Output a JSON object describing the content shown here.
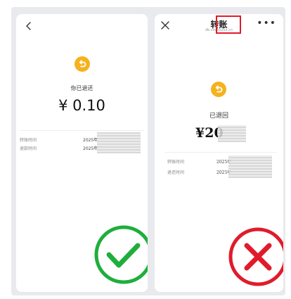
{
  "colors": {
    "accent_yellow": "#f5b21e",
    "check_green": "#1fae3c",
    "cross_red": "#e11b2c",
    "highlight_box": "#e11b2c"
  },
  "left_screen": {
    "back_icon": "chevron-left-icon",
    "status_text": "你已退还",
    "amount": "¥ 0.10",
    "transfer_time_label": "转账时间",
    "transfer_time_value": "2025年",
    "refund_time_label": "退款时间",
    "refund_time_value": "2025年",
    "verdict_icon": "check-icon"
  },
  "right_screen": {
    "close_icon": "close-icon",
    "header_title": "转账",
    "header_subtitle": "db.xxxxxxxx.cn",
    "more_icon": "more-icon",
    "status_text": "已退回",
    "amount": "¥20",
    "transfer_time_label": "转账时间",
    "transfer_time_value": "2025年",
    "refund_time_label": "退还时间",
    "refund_time_value": "2025年",
    "verdict_icon": "cross-icon"
  }
}
